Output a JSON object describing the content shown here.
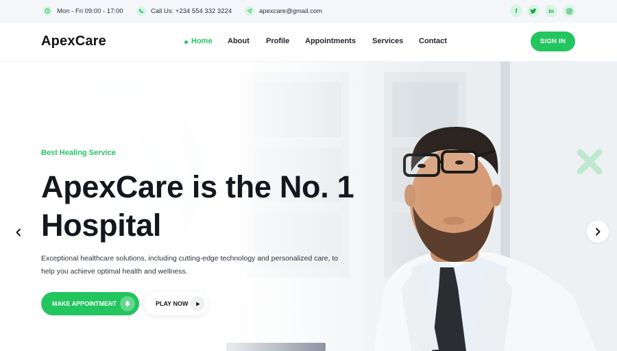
{
  "topbar": {
    "hours": "Mon - Fri 09:00 - 17:00",
    "phone": "Call Us: +234 554 332 3224",
    "email": "apexcare@gmail.com",
    "social_icons": [
      "facebook-icon",
      "twitter-icon",
      "linkedin-icon",
      "instagram-icon"
    ]
  },
  "header": {
    "logo": "ApexCare",
    "nav": [
      {
        "label": "Home",
        "active": true
      },
      {
        "label": "About",
        "active": false
      },
      {
        "label": "Profile",
        "active": false
      },
      {
        "label": "Appointments",
        "active": false
      },
      {
        "label": "Services",
        "active": false
      },
      {
        "label": "Contact",
        "active": false
      }
    ],
    "signin_label": "SIGN IN"
  },
  "hero": {
    "eyebrow": "Best Healing Service",
    "title_line1": "ApexCare is the No. 1",
    "title_line2": "Hospital",
    "description": "Exceptional healthcare solutions, including cutting-edge technology and personalized care, to help you achieve optimal health and wellness.",
    "primary_button": "MAKE APPOINTMENT",
    "secondary_button": "PLAY NOW"
  },
  "colors": {
    "accent": "#22c55e",
    "text_dark": "#14171d",
    "topbar_bg": "#f4f6fa"
  }
}
